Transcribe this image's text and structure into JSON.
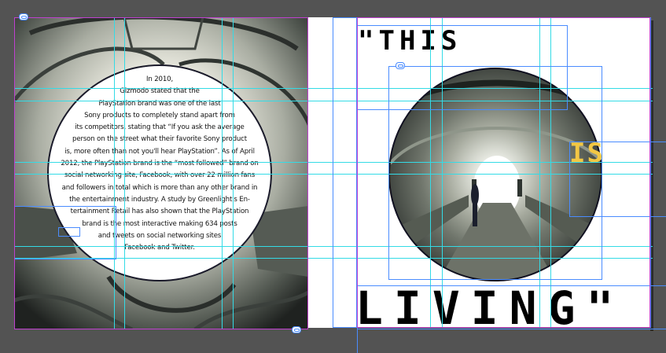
{
  "canvas": {
    "background": "#535353",
    "guide_color": "#33dbe6",
    "frame_color": "#4a8cff",
    "selection_color": "#c040d0"
  },
  "left_page": {
    "body_lines": [
      "In 2010,",
      "Gizmodo stated that the",
      "PlayStation brand was one of the last",
      "Sony products to completely stand apart from",
      "its competitors, stating that “If you ask the average",
      "person on the street what their favorite Sony product",
      "is, more often than not you'll hear PlayStation”. As of April",
      "2012, the PlayStation brand is the “most followed” brand on",
      "social networking site, Facebook, with over 22 million fans",
      "and followers in total which is more than any other brand in",
      "the entertainment industry. A study by Greenlight's En-",
      "tertainment Retail has also shown that the PlayStation",
      "brand is the most interactive making 634 posts",
      "and tweets on social networking sites",
      "Facebook and Twitter."
    ]
  },
  "right_page": {
    "quote_open": "\"THIS",
    "word_is": "IS",
    "word_living": "LIVING\"",
    "accent_color": "#f2c744"
  },
  "icons": {
    "link": "link-icon"
  }
}
